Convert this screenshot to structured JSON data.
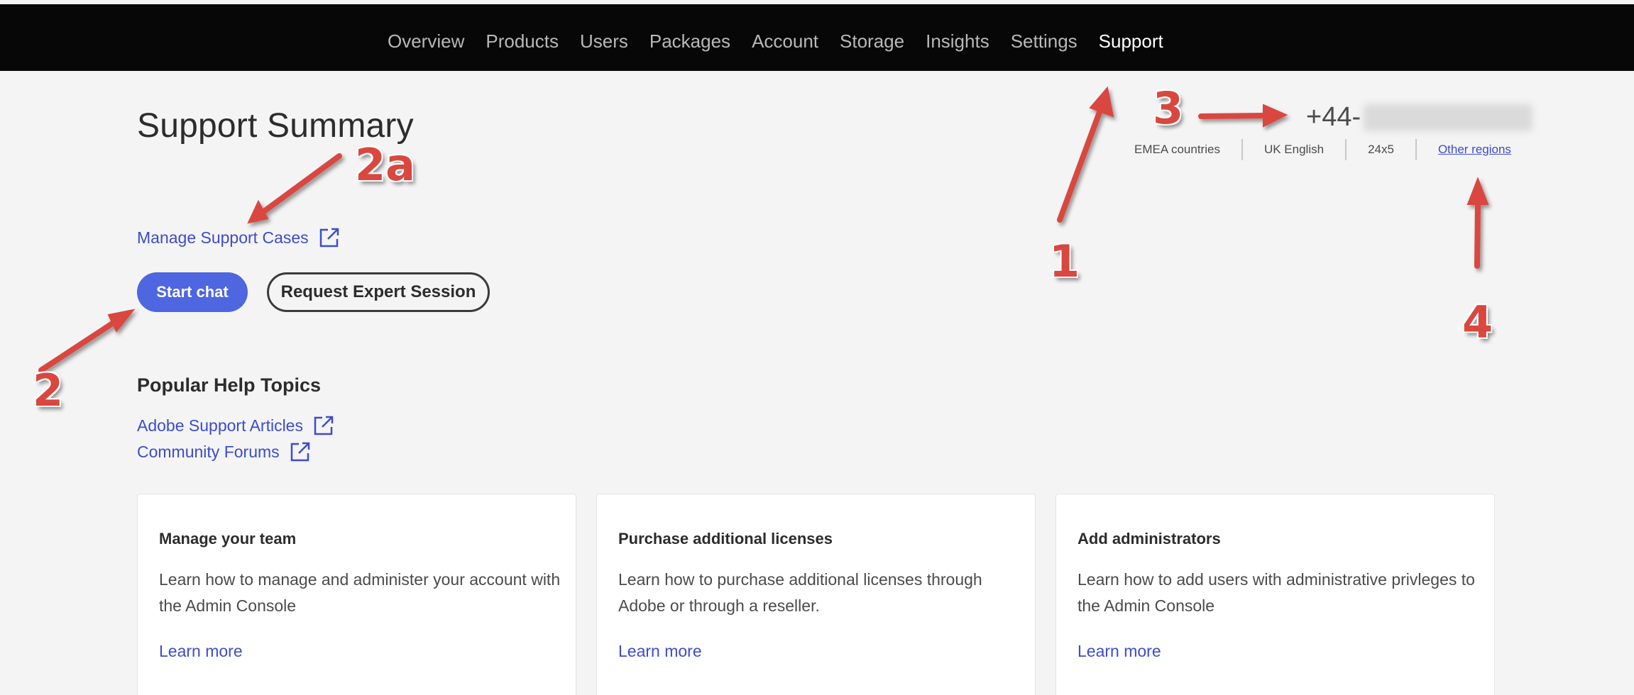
{
  "nav": {
    "items": [
      "Overview",
      "Products",
      "Users",
      "Packages",
      "Account",
      "Storage",
      "Insights",
      "Settings",
      "Support"
    ],
    "active": "Support"
  },
  "page": {
    "title": "Support Summary"
  },
  "contact": {
    "phone_prefix": "+44-",
    "region": "EMEA countries",
    "language": "UK English",
    "hours": "24x5",
    "other_regions_link": "Other regions"
  },
  "links": {
    "manage_cases": "Manage Support Cases",
    "support_articles": "Adobe Support Articles",
    "community_forums": "Community Forums"
  },
  "buttons": {
    "start_chat": "Start chat",
    "request_expert": "Request Expert Session"
  },
  "popular": {
    "title": "Popular Help Topics"
  },
  "cards": [
    {
      "title": "Manage your team",
      "text": "Learn how to manage and administer your account with the Admin Console",
      "link": "Learn more"
    },
    {
      "title": "Purchase additional licenses",
      "text": "Learn how to purchase additional licenses through Adobe or through a reseller.",
      "link": "Learn more"
    },
    {
      "title": "Add administrators",
      "text": "Learn how to add users with administrative privleges to the Admin Console",
      "link": "Learn more"
    }
  ],
  "annotations": {
    "one": "1",
    "two": "2",
    "two_a": "2a",
    "three": "3",
    "four": "4"
  },
  "colors": {
    "accent": "#4e66df",
    "link": "#3d4ccb",
    "annotation": "#d9473f",
    "topbar": "#070707",
    "background": "#f4f4f4"
  }
}
